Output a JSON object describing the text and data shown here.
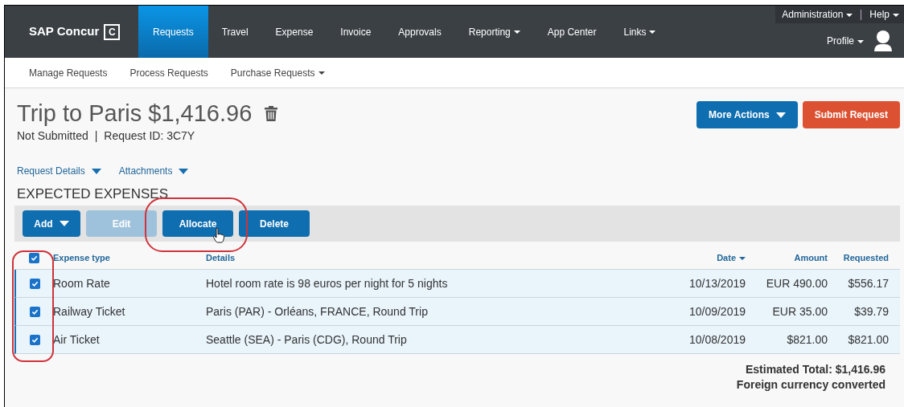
{
  "nav": {
    "logo": "SAP Concur",
    "logo_mark": "C",
    "tabs": [
      {
        "label": "Requests",
        "selected": true,
        "dropdown": false
      },
      {
        "label": "Travel",
        "selected": false,
        "dropdown": false
      },
      {
        "label": "Expense",
        "selected": false,
        "dropdown": false
      },
      {
        "label": "Invoice",
        "selected": false,
        "dropdown": false
      },
      {
        "label": "Approvals",
        "selected": false,
        "dropdown": false
      },
      {
        "label": "Reporting",
        "selected": false,
        "dropdown": true
      },
      {
        "label": "App Center",
        "selected": false,
        "dropdown": false
      },
      {
        "label": "Links",
        "selected": false,
        "dropdown": true
      }
    ],
    "utility": [
      "Administration",
      "Help"
    ],
    "profile": "Profile"
  },
  "subnav": [
    {
      "label": "Manage Requests",
      "dropdown": false
    },
    {
      "label": "Process Requests",
      "dropdown": false
    },
    {
      "label": "Purchase Requests",
      "dropdown": true
    }
  ],
  "request": {
    "title": "Trip to Paris $1,416.96",
    "status": "Not Submitted",
    "separator": "|",
    "request_id": "Request ID: 3C7Y"
  },
  "actions": [
    {
      "label": "More Actions",
      "kind": "primary",
      "dropdown": true
    },
    {
      "label": "Submit Request",
      "kind": "danger",
      "dropdown": false
    }
  ],
  "section_links": [
    "Request Details",
    "Attachments"
  ],
  "section_title": "EXPECTED EXPENSES",
  "toolbar": [
    {
      "label": "Add",
      "dropdown": true,
      "disabled": false
    },
    {
      "label": "Edit",
      "dropdown": false,
      "disabled": true
    },
    {
      "label": "Allocate",
      "dropdown": false,
      "disabled": false
    },
    {
      "label": "Delete",
      "dropdown": false,
      "disabled": false
    }
  ],
  "table": {
    "all_checked": true,
    "columns": [
      "Expense type",
      "Details",
      "Date",
      "Amount",
      "Requested"
    ],
    "rows": [
      {
        "checked": true,
        "cells": [
          "Room Rate",
          "Hotel room rate is 98 euros per night for 5 nights",
          "10/13/2019",
          "EUR 490.00",
          "$556.17"
        ]
      },
      {
        "checked": true,
        "cells": [
          "Railway Ticket",
          "Paris (PAR) - Orléans, FRANCE, Round Trip",
          "10/09/2019",
          "EUR 35.00",
          "$39.79"
        ]
      },
      {
        "checked": true,
        "cells": [
          "Air Ticket",
          "Seattle (SEA) - Paris (CDG), Round Trip",
          "10/08/2019",
          "$821.00",
          "$821.00"
        ]
      }
    ]
  },
  "total": {
    "label": "Estimated Total: $1,416.96",
    "note": "Foreign currency converted"
  }
}
